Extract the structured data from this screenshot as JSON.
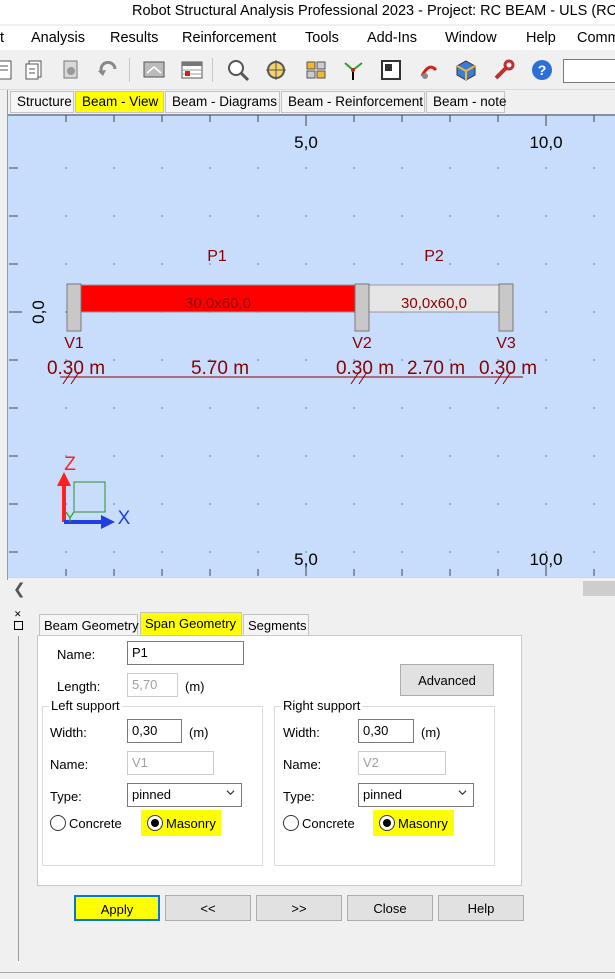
{
  "window": {
    "title": "Robot Structural Analysis Professional 2023 - Project: RC BEAM - ULS  (RC"
  },
  "menu": [
    "t",
    "Analysis",
    "Results",
    "Reinforcement",
    "Tools",
    "Add-Ins",
    "Window",
    "Help",
    "Comm"
  ],
  "toolbar_icons": [
    "document-lines-icon",
    "document-copy-icon",
    "document-gear-icon",
    "undo-arrow-icon",
    "screen-icon",
    "table-icon",
    "zoom-icon",
    "zoom-target-icon",
    "structure-icon",
    "axis-icon",
    "layout-icon",
    "reinforcement-icon",
    "cube-icon",
    "wrench-icon",
    "help-icon"
  ],
  "view_tabs": [
    "Structure",
    "Beam - View",
    "Beam - Diagrams",
    "Beam - Reinforcement",
    "Beam - note"
  ],
  "active_view_tab": "Beam - View",
  "canvas": {
    "ruler_top": [
      "5,0",
      "10,0"
    ],
    "ruler_bottom": [
      "5,0",
      "10,0"
    ],
    "left_axis_label": "0,0",
    "spans": [
      {
        "name": "P1",
        "section": "30,0x60,0",
        "color": "#ff0000",
        "length": "5.70 m"
      },
      {
        "name": "P2",
        "section": "30,0x60,0",
        "color": "#e6e6e6",
        "length": "2.70 m"
      }
    ],
    "supports": [
      {
        "name": "V1",
        "width": "0.30 m"
      },
      {
        "name": "V2",
        "width": "0.30 m"
      },
      {
        "name": "V3",
        "width": "0.30 m"
      }
    ],
    "axes": {
      "z": "Z",
      "x": "X",
      "y": "Y"
    },
    "colors": {
      "background": "#c8dcfc",
      "span_selected": "#ff0000",
      "dimension_text": "#8b0000",
      "axis_z": "#ff2020",
      "axis_x": "#1f3fe0",
      "axis_y": "#2da02d"
    }
  },
  "panel": {
    "tabs": [
      "Beam Geometry",
      "Span Geometry",
      "Segments"
    ],
    "active_tab": "Span Geometry",
    "name_label": "Name:",
    "name_value": "P1",
    "length_label": "Length:",
    "length_value": "5,70",
    "unit": "(m)",
    "advanced_label": "Advanced",
    "left_support": {
      "title": "Left support",
      "width_label": "Width:",
      "width_value": "0,30",
      "name_label": "Name:",
      "name_value": "V1",
      "type_label": "Type:",
      "type_value": "pinned",
      "concrete_label": "Concrete",
      "masonry_label": "Masonry"
    },
    "right_support": {
      "title": "Right support",
      "width_label": "Width:",
      "width_value": "0,30",
      "name_label": "Name:",
      "name_value": "V2",
      "type_label": "Type:",
      "type_value": "pinned",
      "concrete_label": "Concrete",
      "masonry_label": "Masonry"
    },
    "buttons": {
      "apply": "Apply",
      "prev": "<<",
      "next": ">>",
      "close": "Close",
      "help": "Help"
    }
  }
}
